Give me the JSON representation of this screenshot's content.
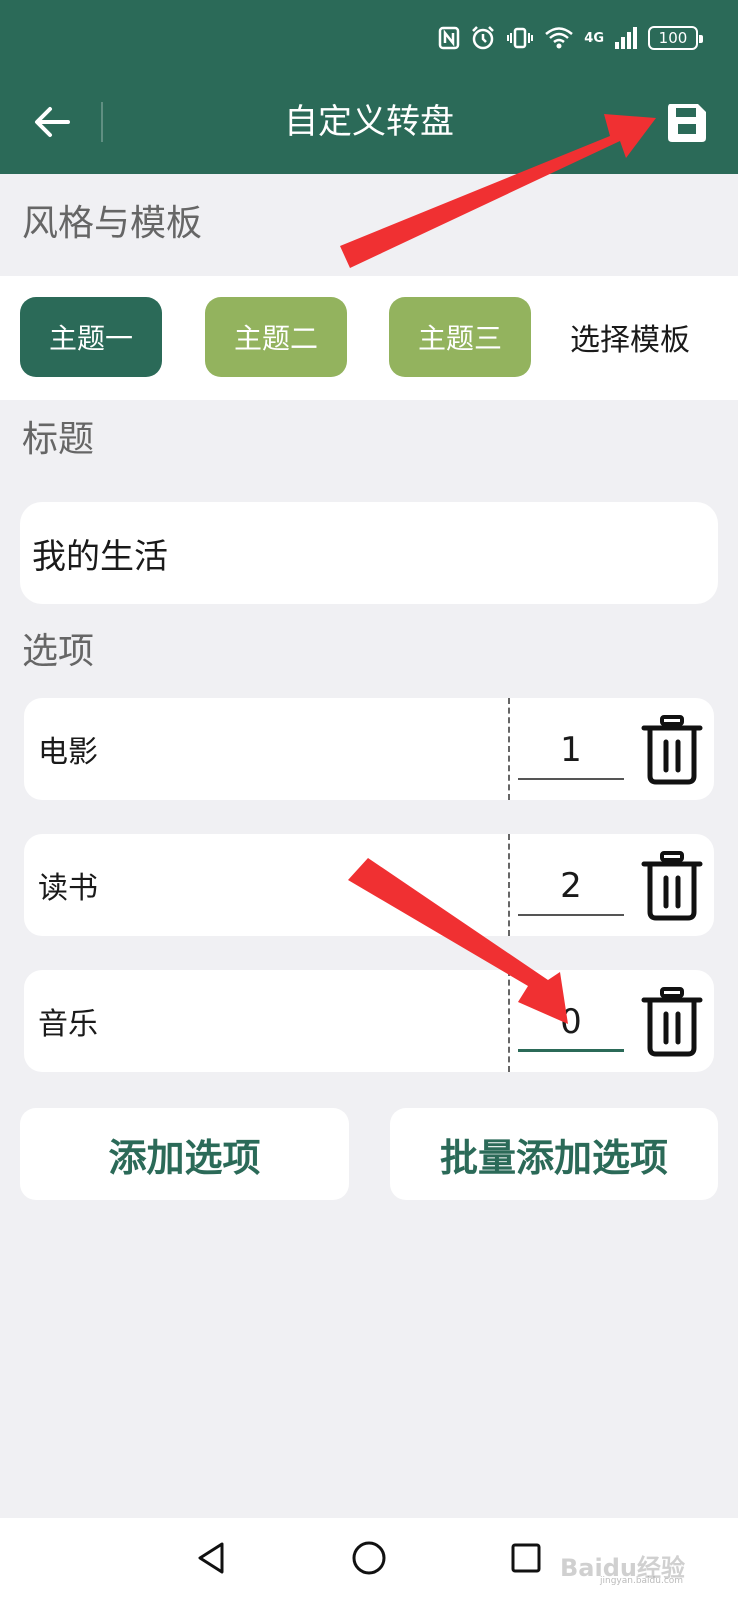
{
  "header": {
    "title": "自定义转盘",
    "status": {
      "network": "4G",
      "battery": "100"
    }
  },
  "style_section": {
    "label": "风格与模板",
    "themes": [
      {
        "label": "主题一",
        "color": "#2b6a58",
        "selected": true
      },
      {
        "label": "主题二",
        "color": "#93b35e",
        "selected": false
      },
      {
        "label": "主题三",
        "color": "#93b35e",
        "selected": false
      }
    ],
    "template_link": "选择模板"
  },
  "title_section": {
    "label": "标题",
    "value": "我的生活"
  },
  "options_section": {
    "label": "选项",
    "items": [
      {
        "name": "电影",
        "weight": "1"
      },
      {
        "name": "读书",
        "weight": "2"
      },
      {
        "name": "音乐",
        "weight": "0"
      }
    ]
  },
  "actions": {
    "add_option": "添加选项",
    "batch_add": "批量添加选项"
  },
  "watermark": {
    "brand": "Baidu经验",
    "site": "jingyan.baidu.com"
  },
  "colors": {
    "primary": "#2b6a58",
    "secondary": "#93b35e",
    "annotation": "#f03032",
    "background": "#f0f0f3"
  }
}
